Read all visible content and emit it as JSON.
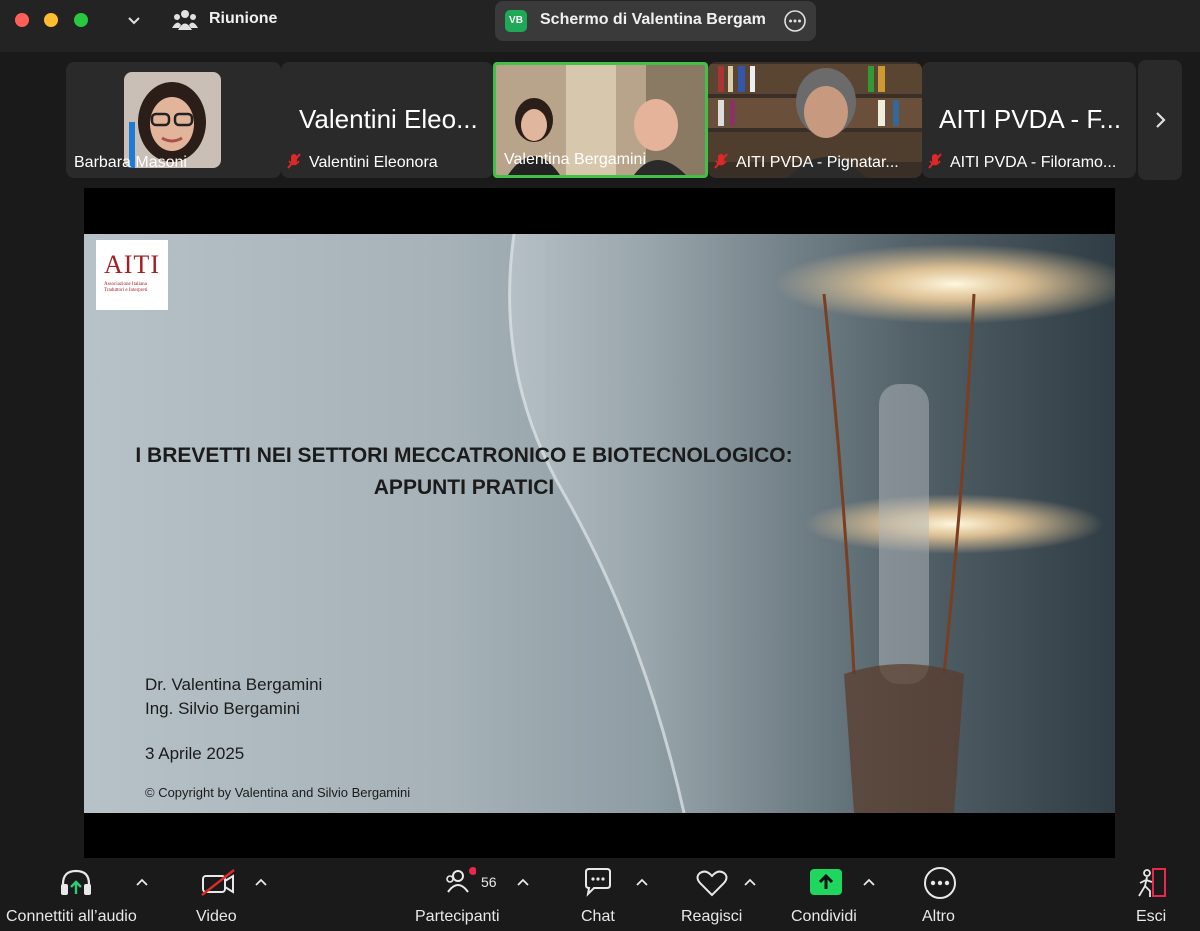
{
  "titlebar": {
    "meeting_label": "Riunione",
    "share_badge": "VB",
    "share_title": "Schermo di Valentina Bergam"
  },
  "thumbnails": [
    {
      "name": "Barbara Masoni",
      "muted": false
    },
    {
      "name": "Valentini Eleonora",
      "big_label": "Valentini Eleo...",
      "muted": true
    },
    {
      "name": "Valentina Bergamini",
      "muted": false,
      "active": true
    },
    {
      "name": "AITI PVDA - Pignatar...",
      "muted": true
    },
    {
      "name": "AITI PVDA - Filoramo...",
      "big_label": "AITI PVDA - F...",
      "muted": true
    }
  ],
  "slide": {
    "logo_text": "AITI",
    "logo_sub": "Associazione Italiana Traduttori e Interpreti",
    "title_line1": "I BREVETTI NEI SETTORI MECCATRONICO E BIOTECNOLOGICO:",
    "title_line2": "APPUNTI PRATICI",
    "author1": "Dr. Valentina Bergamini",
    "author2": "Ing. Silvio Bergamini",
    "date": "3 Aprile 2025",
    "copyright": "© Copyright by Valentina and Silvio Bergamini"
  },
  "toolbar": {
    "audio": "Connettiti all’audio",
    "video": "Video",
    "participants": "Partecipanti",
    "participants_count": "56",
    "chat": "Chat",
    "react": "Reagisci",
    "share": "Condividi",
    "more": "Altro",
    "leave": "Esci"
  },
  "colors": {
    "share_green": "#1fa855",
    "active_border": "#43c04a",
    "mute_red": "#e02828",
    "more_blue": "#0e72ed"
  }
}
